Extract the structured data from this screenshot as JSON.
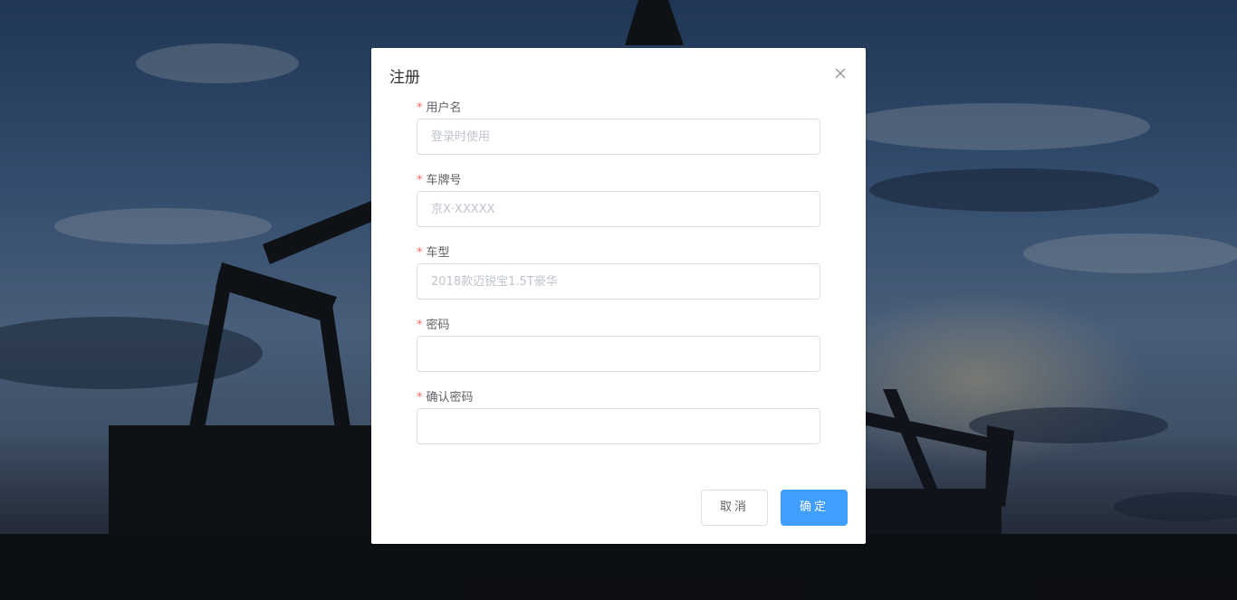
{
  "dialog": {
    "title": "注册",
    "close_icon": "close-icon"
  },
  "form": {
    "username": {
      "label": "用户名",
      "required_mark": "*",
      "value": "",
      "placeholder": "登录时使用"
    },
    "plate": {
      "label": "车牌号",
      "required_mark": "*",
      "value": "",
      "placeholder": "京X·XXXXX"
    },
    "model": {
      "label": "车型",
      "required_mark": "*",
      "value": "",
      "placeholder": "2018款迈锐宝1.5T豪华"
    },
    "password": {
      "label": "密码",
      "required_mark": "*",
      "value": "",
      "placeholder": ""
    },
    "confirm_password": {
      "label": "确认密码",
      "required_mark": "*",
      "value": "",
      "placeholder": ""
    }
  },
  "footer": {
    "cancel_label": "取消",
    "confirm_label": "确定"
  },
  "colors": {
    "primary": "#409eff",
    "required": "#f56c6c",
    "border": "#dcdfe6",
    "placeholder": "#c0c4cc"
  }
}
